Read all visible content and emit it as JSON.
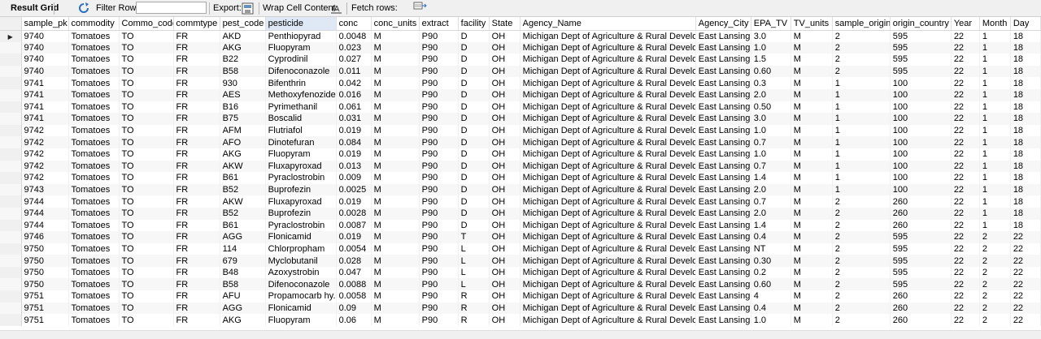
{
  "toolbar": {
    "title": "Result Grid",
    "filter_label": "Filter Rows:",
    "filter_value": "",
    "export_label": "Export:",
    "wrap_label": "Wrap Cell Content:",
    "fetch_label": "Fetch rows:",
    "icons": [
      "refresh-icon",
      "export-icon",
      "wrap-icon",
      "fetch-rows-icon"
    ]
  },
  "columns": [
    "sample_pk",
    "commodity",
    "Commo_code",
    "commtype",
    "pest_code",
    "pesticide",
    "conc",
    "conc_units",
    "extract",
    "facility",
    "State",
    "Agency_Name",
    "Agency_City",
    "EPA_TV",
    "TV_units",
    "sample_origin",
    "origin_country",
    "Year",
    "Month",
    "Day"
  ],
  "sorted_column": "pesticide",
  "rows": [
    [
      "9740",
      "Tomatoes",
      "TO",
      "FR",
      "AKD",
      "Penthiopyrad",
      "0.0048",
      "M",
      "P90",
      "D",
      "OH",
      "Michigan Dept of Agriculture & Rural Development",
      "East Lansing",
      "3.0",
      "M",
      "2",
      "595",
      "22",
      "1",
      "18"
    ],
    [
      "9740",
      "Tomatoes",
      "TO",
      "FR",
      "AKG",
      "Fluopyram",
      "0.023",
      "M",
      "P90",
      "D",
      "OH",
      "Michigan Dept of Agriculture & Rural Development",
      "East Lansing",
      "1.0",
      "M",
      "2",
      "595",
      "22",
      "1",
      "18"
    ],
    [
      "9740",
      "Tomatoes",
      "TO",
      "FR",
      "B22",
      "Cyprodinil",
      "0.027",
      "M",
      "P90",
      "D",
      "OH",
      "Michigan Dept of Agriculture & Rural Development",
      "East Lansing",
      "1.5",
      "M",
      "2",
      "595",
      "22",
      "1",
      "18"
    ],
    [
      "9740",
      "Tomatoes",
      "TO",
      "FR",
      "B58",
      "Difenoconazole",
      "0.011",
      "M",
      "P90",
      "D",
      "OH",
      "Michigan Dept of Agriculture & Rural Development",
      "East Lansing",
      "0.60",
      "M",
      "2",
      "595",
      "22",
      "1",
      "18"
    ],
    [
      "9741",
      "Tomatoes",
      "TO",
      "FR",
      "930",
      "Bifenthrin",
      "0.042",
      "M",
      "P90",
      "D",
      "OH",
      "Michigan Dept of Agriculture & Rural Development",
      "East Lansing",
      "0.3",
      "M",
      "1",
      "100",
      "22",
      "1",
      "18"
    ],
    [
      "9741",
      "Tomatoes",
      "TO",
      "FR",
      "AES",
      "Methoxyfenozide",
      "0.016",
      "M",
      "P90",
      "D",
      "OH",
      "Michigan Dept of Agriculture & Rural Development",
      "East Lansing",
      "2.0",
      "M",
      "1",
      "100",
      "22",
      "1",
      "18"
    ],
    [
      "9741",
      "Tomatoes",
      "TO",
      "FR",
      "B16",
      "Pyrimethanil",
      "0.061",
      "M",
      "P90",
      "D",
      "OH",
      "Michigan Dept of Agriculture & Rural Development",
      "East Lansing",
      "0.50",
      "M",
      "1",
      "100",
      "22",
      "1",
      "18"
    ],
    [
      "9741",
      "Tomatoes",
      "TO",
      "FR",
      "B75",
      "Boscalid",
      "0.031",
      "M",
      "P90",
      "D",
      "OH",
      "Michigan Dept of Agriculture & Rural Development",
      "East Lansing",
      "3.0",
      "M",
      "1",
      "100",
      "22",
      "1",
      "18"
    ],
    [
      "9742",
      "Tomatoes",
      "TO",
      "FR",
      "AFM",
      "Flutriafol",
      "0.019",
      "M",
      "P90",
      "D",
      "OH",
      "Michigan Dept of Agriculture & Rural Development",
      "East Lansing",
      "1.0",
      "M",
      "1",
      "100",
      "22",
      "1",
      "18"
    ],
    [
      "9742",
      "Tomatoes",
      "TO",
      "FR",
      "AFO",
      "Dinotefuran",
      "0.084",
      "M",
      "P90",
      "D",
      "OH",
      "Michigan Dept of Agriculture & Rural Development",
      "East Lansing",
      "0.7",
      "M",
      "1",
      "100",
      "22",
      "1",
      "18"
    ],
    [
      "9742",
      "Tomatoes",
      "TO",
      "FR",
      "AKG",
      "Fluopyram",
      "0.019",
      "M",
      "P90",
      "D",
      "OH",
      "Michigan Dept of Agriculture & Rural Development",
      "East Lansing",
      "1.0",
      "M",
      "1",
      "100",
      "22",
      "1",
      "18"
    ],
    [
      "9742",
      "Tomatoes",
      "TO",
      "FR",
      "AKW",
      "Fluxapyroxad",
      "0.013",
      "M",
      "P90",
      "D",
      "OH",
      "Michigan Dept of Agriculture & Rural Development",
      "East Lansing",
      "0.7",
      "M",
      "1",
      "100",
      "22",
      "1",
      "18"
    ],
    [
      "9742",
      "Tomatoes",
      "TO",
      "FR",
      "B61",
      "Pyraclostrobin",
      "0.009",
      "M",
      "P90",
      "D",
      "OH",
      "Michigan Dept of Agriculture & Rural Development",
      "East Lansing",
      "1.4",
      "M",
      "1",
      "100",
      "22",
      "1",
      "18"
    ],
    [
      "9743",
      "Tomatoes",
      "TO",
      "FR",
      "B52",
      "Buprofezin",
      "0.0025",
      "M",
      "P90",
      "D",
      "OH",
      "Michigan Dept of Agriculture & Rural Development",
      "East Lansing",
      "2.0",
      "M",
      "1",
      "100",
      "22",
      "1",
      "18"
    ],
    [
      "9744",
      "Tomatoes",
      "TO",
      "FR",
      "AKW",
      "Fluxapyroxad",
      "0.019",
      "M",
      "P90",
      "D",
      "OH",
      "Michigan Dept of Agriculture & Rural Development",
      "East Lansing",
      "0.7",
      "M",
      "2",
      "260",
      "22",
      "1",
      "18"
    ],
    [
      "9744",
      "Tomatoes",
      "TO",
      "FR",
      "B52",
      "Buprofezin",
      "0.0028",
      "M",
      "P90",
      "D",
      "OH",
      "Michigan Dept of Agriculture & Rural Development",
      "East Lansing",
      "2.0",
      "M",
      "2",
      "260",
      "22",
      "1",
      "18"
    ],
    [
      "9744",
      "Tomatoes",
      "TO",
      "FR",
      "B61",
      "Pyraclostrobin",
      "0.0087",
      "M",
      "P90",
      "D",
      "OH",
      "Michigan Dept of Agriculture & Rural Development",
      "East Lansing",
      "1.4",
      "M",
      "2",
      "260",
      "22",
      "1",
      "18"
    ],
    [
      "9746",
      "Tomatoes",
      "TO",
      "FR",
      "AGG",
      "Flonicamid",
      "0.019",
      "M",
      "P90",
      "T",
      "OH",
      "Michigan Dept of Agriculture & Rural Development",
      "East Lansing",
      "0.4",
      "M",
      "2",
      "595",
      "22",
      "2",
      "22"
    ],
    [
      "9750",
      "Tomatoes",
      "TO",
      "FR",
      "114",
      "Chlorpropham",
      "0.0054",
      "M",
      "P90",
      "L",
      "OH",
      "Michigan Dept of Agriculture & Rural Development",
      "East Lansing",
      "NT",
      "M",
      "2",
      "595",
      "22",
      "2",
      "22"
    ],
    [
      "9750",
      "Tomatoes",
      "TO",
      "FR",
      "679",
      "Myclobutanil",
      "0.028",
      "M",
      "P90",
      "L",
      "OH",
      "Michigan Dept of Agriculture & Rural Development",
      "East Lansing",
      "0.30",
      "M",
      "2",
      "595",
      "22",
      "2",
      "22"
    ],
    [
      "9750",
      "Tomatoes",
      "TO",
      "FR",
      "B48",
      "Azoxystrobin",
      "0.047",
      "M",
      "P90",
      "L",
      "OH",
      "Michigan Dept of Agriculture & Rural Development",
      "East Lansing",
      "0.2",
      "M",
      "2",
      "595",
      "22",
      "2",
      "22"
    ],
    [
      "9750",
      "Tomatoes",
      "TO",
      "FR",
      "B58",
      "Difenoconazole",
      "0.0088",
      "M",
      "P90",
      "L",
      "OH",
      "Michigan Dept of Agriculture & Rural Development",
      "East Lansing",
      "0.60",
      "M",
      "2",
      "595",
      "22",
      "2",
      "22"
    ],
    [
      "9751",
      "Tomatoes",
      "TO",
      "FR",
      "AFU",
      "Propamocarb hy...",
      "0.0058",
      "M",
      "P90",
      "R",
      "OH",
      "Michigan Dept of Agriculture & Rural Development",
      "East Lansing",
      "4",
      "M",
      "2",
      "260",
      "22",
      "2",
      "22"
    ],
    [
      "9751",
      "Tomatoes",
      "TO",
      "FR",
      "AGG",
      "Flonicamid",
      "0.09",
      "M",
      "P90",
      "R",
      "OH",
      "Michigan Dept of Agriculture & Rural Development",
      "East Lansing",
      "0.4",
      "M",
      "2",
      "260",
      "22",
      "2",
      "22"
    ],
    [
      "9751",
      "Tomatoes",
      "TO",
      "FR",
      "AKG",
      "Fluopyram",
      "0.06",
      "M",
      "P90",
      "R",
      "OH",
      "Michigan Dept of Agriculture & Rural Development",
      "East Lansing",
      "1.0",
      "M",
      "2",
      "260",
      "22",
      "2",
      "22"
    ]
  ],
  "selected_row": 0
}
